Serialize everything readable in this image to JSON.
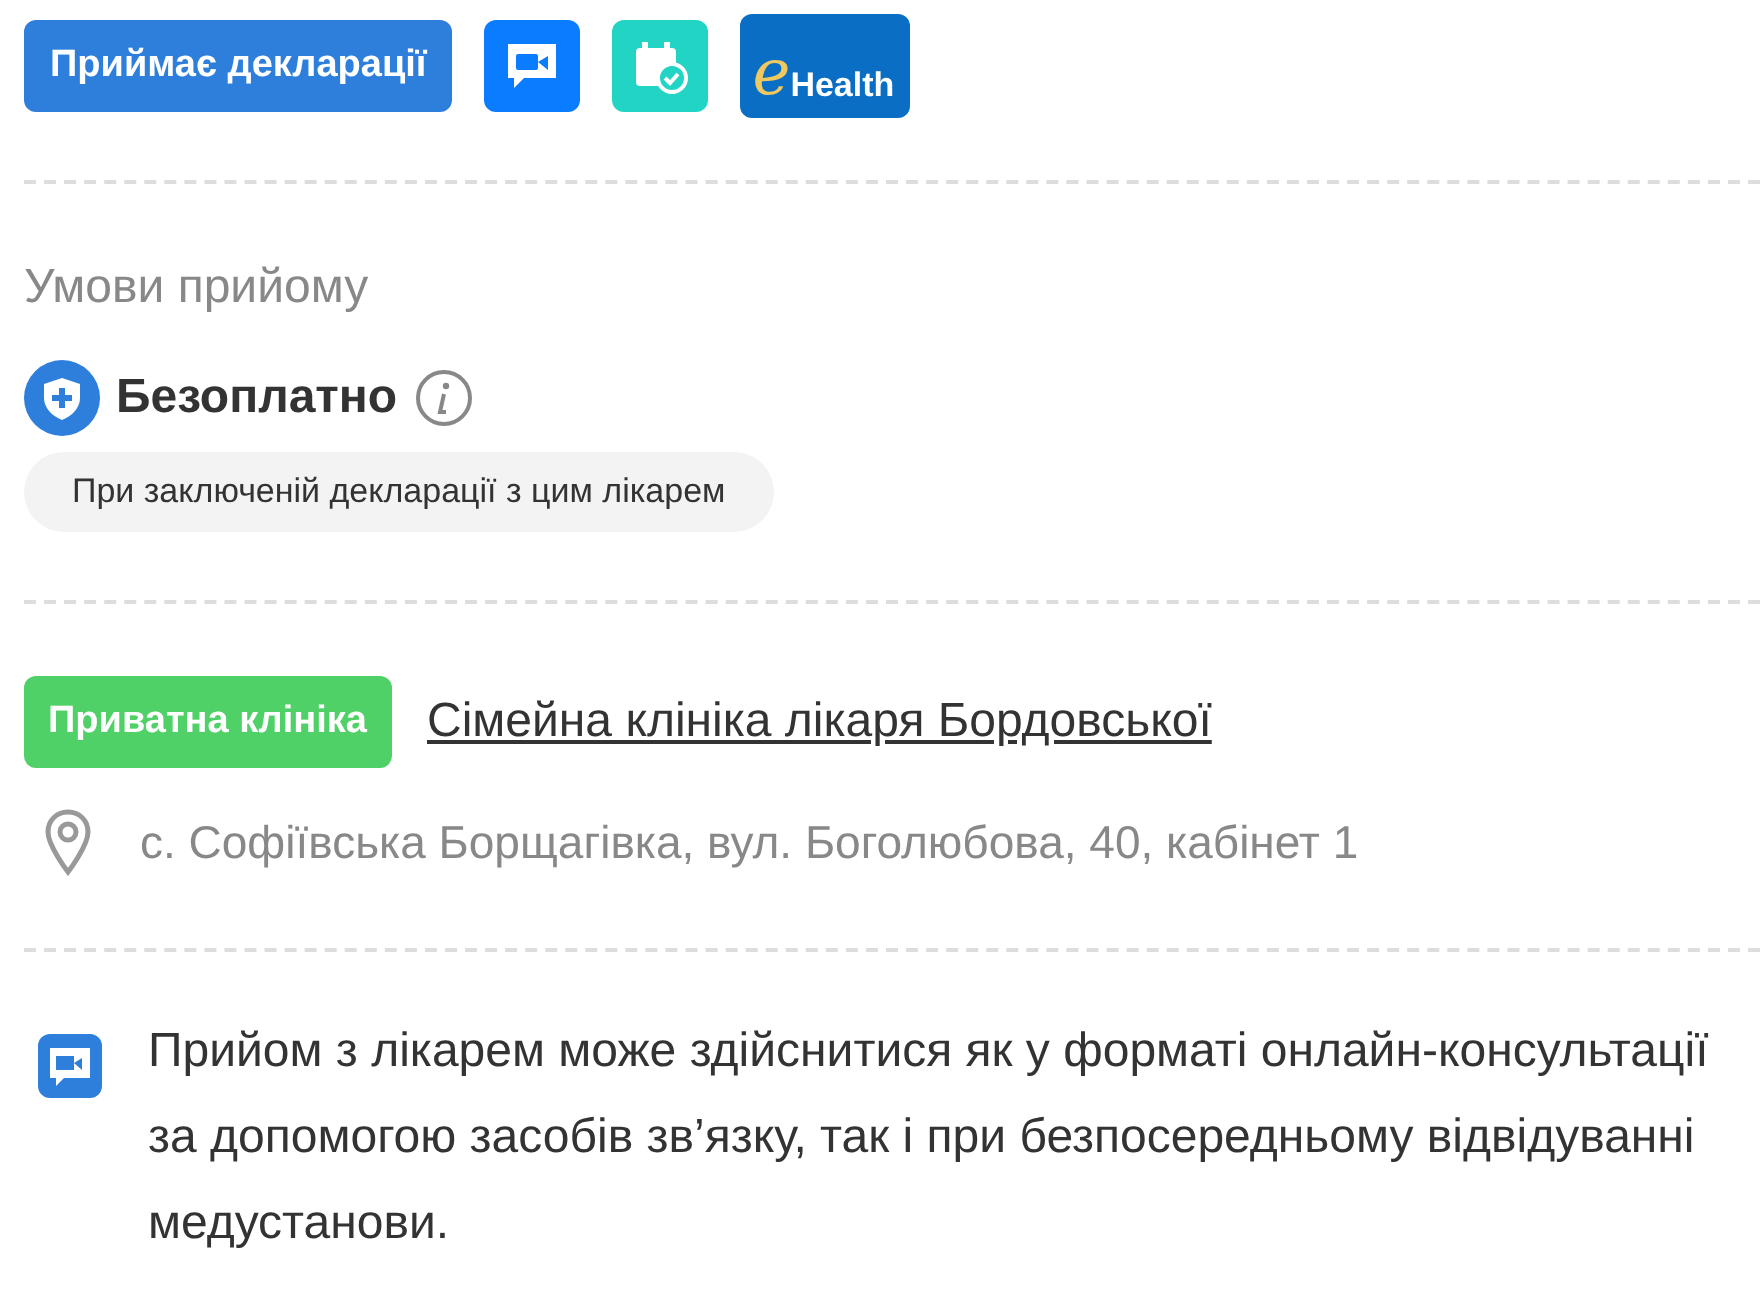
{
  "badges": [
    {
      "kind": "label",
      "text": "Приймає декларації"
    },
    {
      "kind": "video"
    },
    {
      "kind": "calendar"
    },
    {
      "kind": "ehealth",
      "letter": "e",
      "text": "Health"
    }
  ],
  "conditions": {
    "title": "Умови прийому",
    "price": "Безоплатно",
    "note": "При заключеній декларації з цим лікарем"
  },
  "clinic": {
    "type": "Приватна клініка",
    "name": "Сімейна клініка лікаря Бордовської",
    "address": "с. Софіївська Борщагівка, вул. Боголюбова, 40, кабінет 1"
  },
  "info": "Прийом з лікарем може здійснитися як у форматі онлайн-консультації за допомогою засобів зв’язку, так і при безпосередньому відвідуванні медустанови."
}
